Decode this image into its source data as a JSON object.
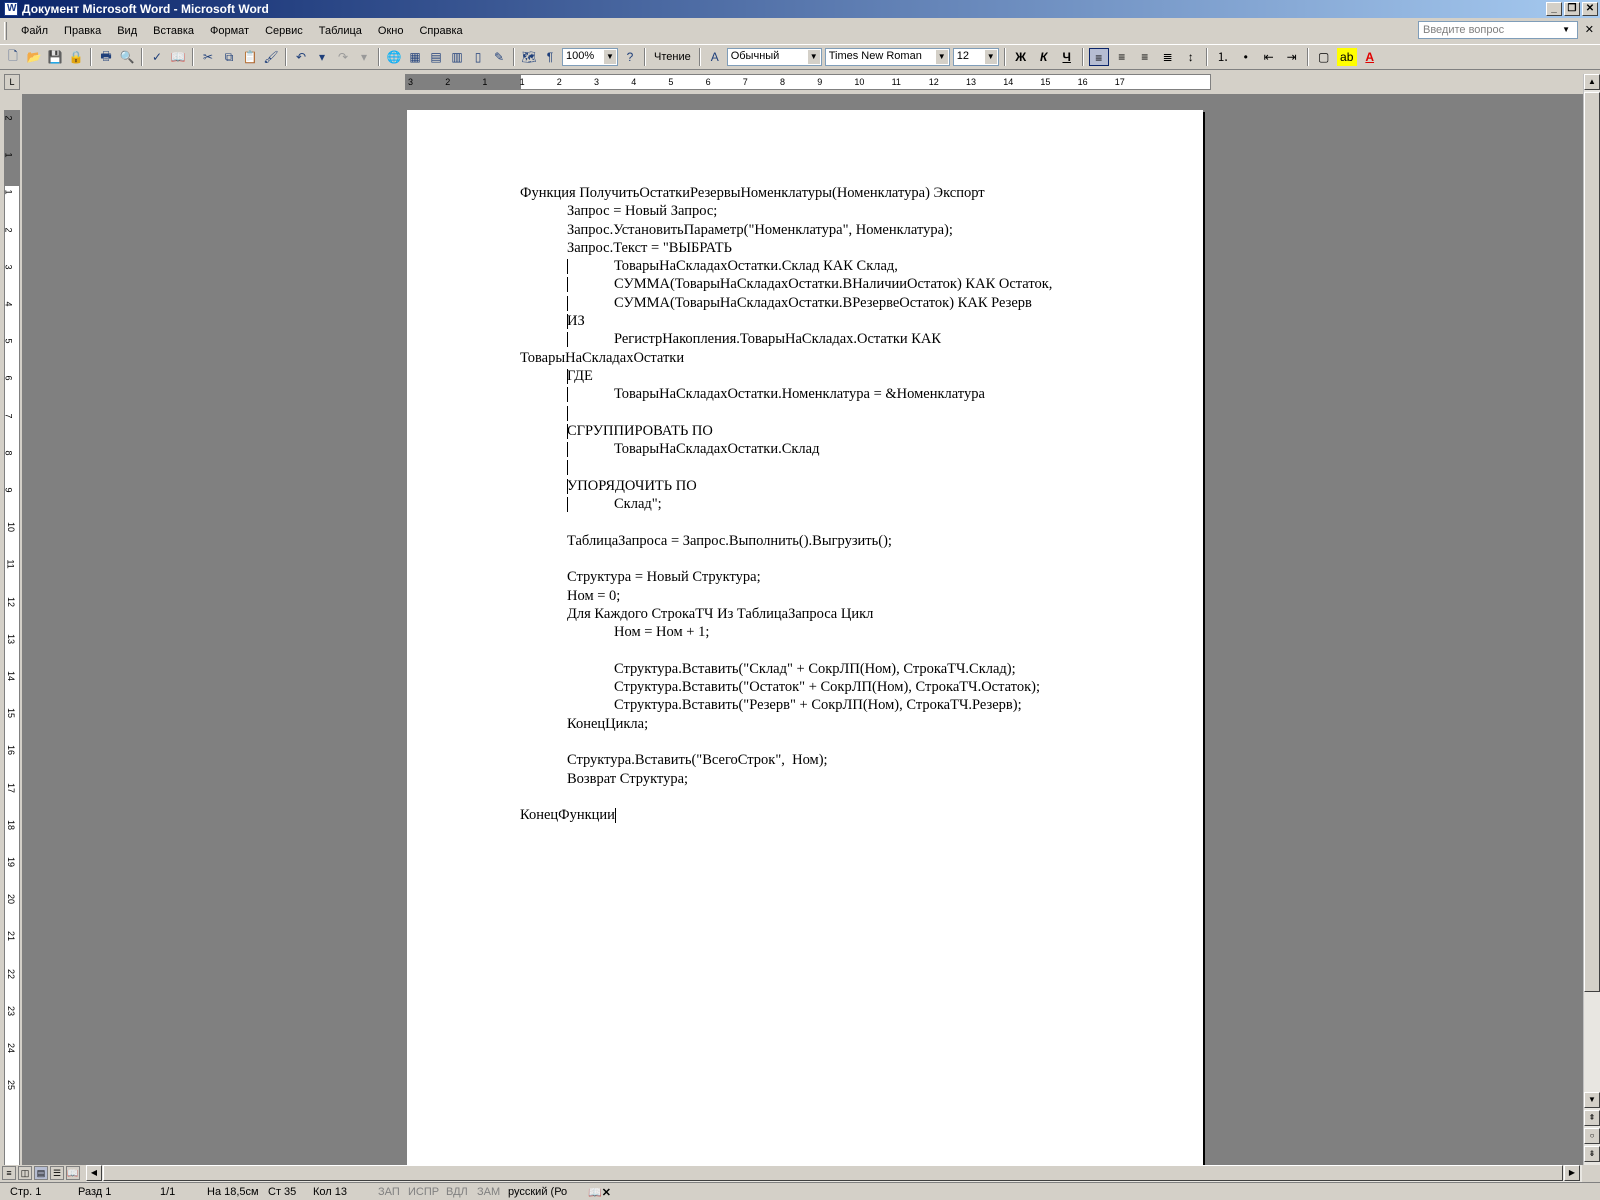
{
  "window": {
    "title": "Документ Microsoft Word - Microsoft Word"
  },
  "menu": {
    "items": [
      "Файл",
      "Правка",
      "Вид",
      "Вставка",
      "Формат",
      "Сервис",
      "Таблица",
      "Окно",
      "Справка"
    ],
    "ask_placeholder": "Введите вопрос"
  },
  "toolbar": {
    "zoom": "100%",
    "reading_mode": "Чтение",
    "style": "Обычный",
    "font": "Times New Roman",
    "size": "12",
    "bold": "Ж",
    "italic": "К",
    "underline": "Ч"
  },
  "ruler": {
    "h_ticks": [
      "3",
      "2",
      "1",
      "1",
      "2",
      "3",
      "4",
      "5",
      "6",
      "7",
      "8",
      "9",
      "10",
      "11",
      "12",
      "13",
      "14",
      "15",
      "16",
      "17"
    ],
    "v_ticks": [
      "2",
      "1",
      "1",
      "2",
      "3",
      "4",
      "5",
      "6",
      "7",
      "8",
      "9",
      "10",
      "11",
      "12",
      "13",
      "14",
      "15",
      "16",
      "17",
      "18",
      "19",
      "20",
      "21",
      "22",
      "23",
      "24",
      "25"
    ]
  },
  "document": {
    "lines": [
      "Функция ПолучитьОстаткиРезервыНоменклатуры(Номенклатура) Экспорт",
      "Запрос = Новый Запрос;",
      "Запрос.УстановитьПараметр(\"Номенклатура\", Номенклатура);",
      "Запрос.Текст = \"ВЫБРАТЬ",
      "ТоварыНаСкладахОстатки.Склад КАК Склад,",
      "СУММА(ТоварыНаСкладахОстатки.ВНаличииОстаток) КАК Остаток,",
      "СУММА(ТоварыНаСкладахОстатки.ВРезервеОстаток) КАК Резерв",
      "ИЗ",
      "РегистрНакопления.ТоварыНаСкладах.Остатки КАК",
      "ТоварыНаСкладахОстатки",
      "ГДЕ",
      "ТоварыНаСкладахОстатки.Номенклатура = &Номенклатура",
      "",
      "СГРУППИРОВАТЬ ПО",
      "ТоварыНаСкладахОстатки.Склад",
      "",
      "УПОРЯДОЧИТЬ ПО",
      "Склад\";",
      "",
      "ТаблицаЗапроса = Запрос.Выполнить().Выгрузить();",
      "",
      "Структура = Новый Структура;",
      "Ном = 0;",
      "Для Каждого СтрокаТЧ Из ТаблицаЗапроса Цикл",
      "Ном = Ном + 1;",
      "",
      "Структура.Вставить(\"Склад\" + СокрЛП(Ном), СтрокаТЧ.Склад);",
      "Структура.Вставить(\"Остаток\" + СокрЛП(Ном), СтрокаТЧ.Остаток);",
      "Структура.Вставить(\"Резерв\" + СокрЛП(Ном), СтрокаТЧ.Резерв);",
      "КонецЦикла;",
      "",
      "Структура.Вставить(\"ВсегоСтрок\",  Ном);",
      "Возврат Структура;",
      "",
      "КонецФункции"
    ]
  },
  "status": {
    "page": "Стр. 1",
    "section": "Разд 1",
    "pages": "1/1",
    "at": "На 18,5см",
    "line": "Ст 35",
    "col": "Кол 13",
    "rec": "ЗАП",
    "trk": "ИСПР",
    "ext": "ВДЛ",
    "ovr": "ЗАМ",
    "lang": "русский (Ро"
  }
}
